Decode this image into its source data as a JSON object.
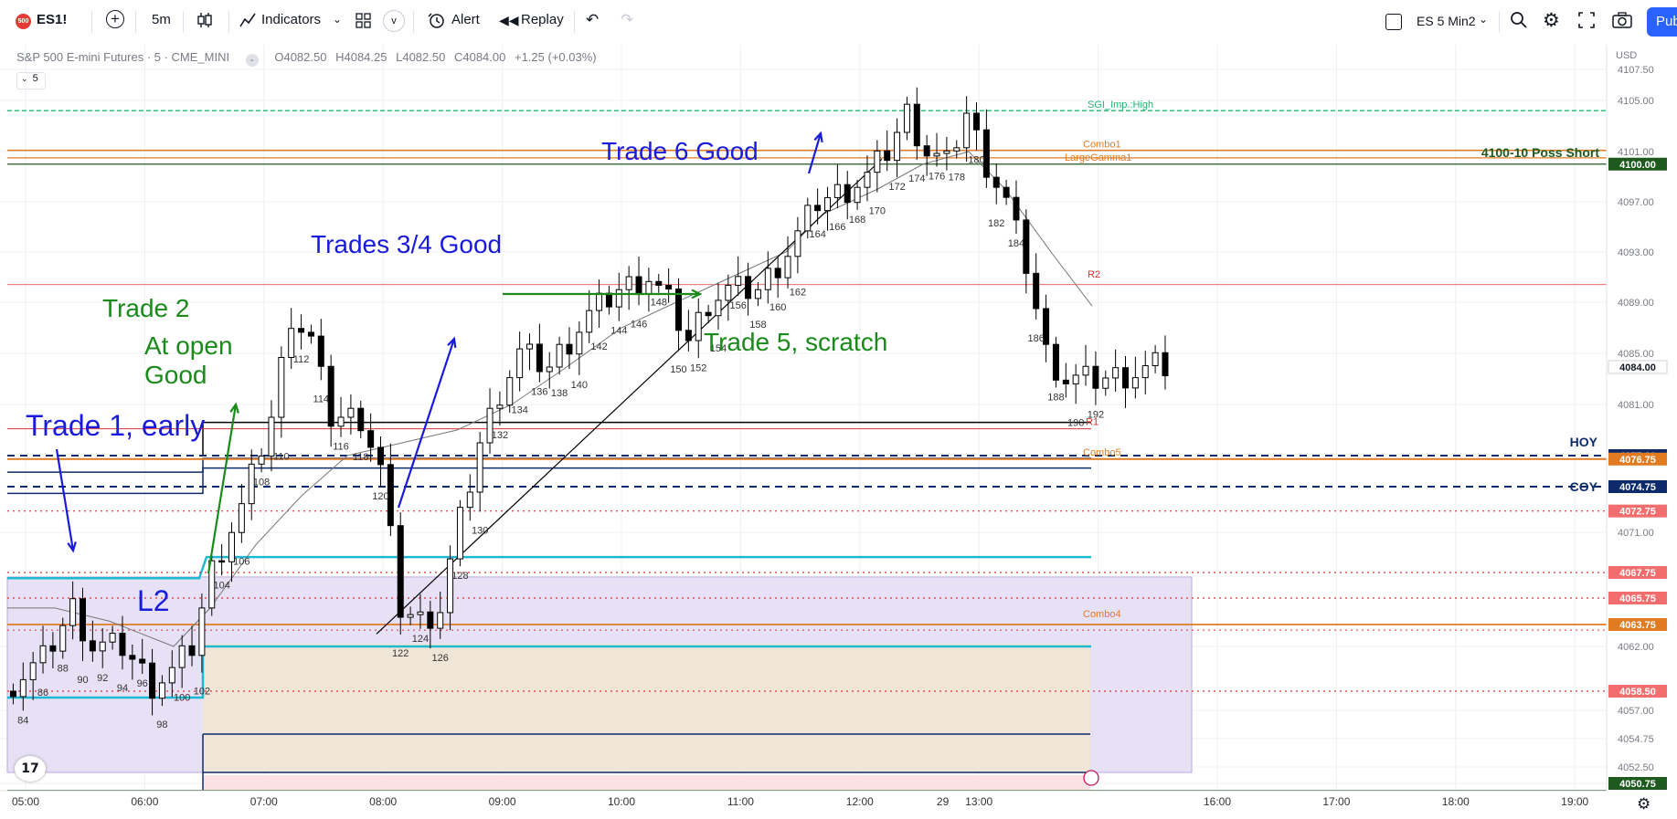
{
  "toolbar": {
    "symbol_badge": "500",
    "symbol": "ES1!",
    "interval": "5m",
    "indicators": "Indicators",
    "alert": "Alert",
    "replay": "Replay",
    "layout_name": "ES 5 Min2",
    "publish": "Pub"
  },
  "legend": {
    "title": "S&P 500 E-mini Futures · 5 · CME_MINI",
    "open": "O4082.50",
    "high": "H4084.25",
    "low": "L4082.50",
    "close": "C4084.00",
    "change": "+1.25 (+0.03%)",
    "study_count": "5"
  },
  "chart_data": {
    "type": "candlestick",
    "currency": "USD",
    "x_axis": {
      "ticks": [
        "05:00",
        "06:00",
        "07:00",
        "08:00",
        "09:00",
        "10:00",
        "11:00",
        "12:00",
        "13:00",
        "29",
        "16:00",
        "17:00",
        "18:00",
        "19:00"
      ]
    },
    "y_axis": {
      "ticks": [
        "4107.50",
        "4105.00",
        "4101.00",
        "4097.00",
        "4093.00",
        "4089.00",
        "4085.00",
        "4081.00",
        "4071.00",
        "4062.00",
        "4057.00",
        "4054.75",
        "4052.50",
        "4050.75"
      ]
    },
    "price_tags": [
      {
        "value": "4100.00",
        "bg": "#1e5a1e",
        "fg": "#ffffff"
      },
      {
        "value": "4084.00",
        "bg": "#ffffff",
        "fg": "#131722"
      },
      {
        "value": "4077.00",
        "bg": "#0d2b6b",
        "fg": "#ffffff"
      },
      {
        "value": "4076.75",
        "bg": "#e07b22",
        "fg": "#ffffff"
      },
      {
        "value": "4074.75",
        "bg": "#0d2b6b",
        "fg": "#ffffff"
      },
      {
        "value": "4072.75",
        "bg": "#f26d6d",
        "fg": "#ffffff"
      },
      {
        "value": "4067.75",
        "bg": "#f26d6d",
        "fg": "#ffffff"
      },
      {
        "value": "4065.75",
        "bg": "#f26d6d",
        "fg": "#ffffff"
      },
      {
        "value": "4063.75",
        "bg": "#e07b22",
        "fg": "#ffffff"
      },
      {
        "value": "4058.50",
        "bg": "#f26d6d",
        "fg": "#ffffff"
      },
      {
        "value": "4050.75",
        "bg": "#1e5a1e",
        "fg": "#ffffff"
      }
    ],
    "level_labels": [
      {
        "text": "SGI_Imp.:High",
        "color": "#22b573"
      },
      {
        "text": "Combo1",
        "color": "#e07b22"
      },
      {
        "text": "LargeGamma1",
        "color": "#e07b22"
      },
      {
        "text": "4100-10 Poss Short",
        "color": "#1e5a1e"
      },
      {
        "text": "R2",
        "color": "#e03030"
      },
      {
        "text": "R1",
        "color": "#e03030"
      },
      {
        "text": "HOY",
        "color": "#0d2b6b"
      },
      {
        "text": "COY",
        "color": "#0d2b6b"
      },
      {
        "text": "Combo5",
        "color": "#e07b22"
      },
      {
        "text": "Combo4",
        "color": "#e07b22"
      }
    ],
    "bar_numbers": [
      "84",
      "86",
      "88",
      "90",
      "92",
      "94",
      "96",
      "98",
      "100",
      "102",
      "104",
      "106",
      "108",
      "110",
      "112",
      "114",
      "116",
      "118",
      "120",
      "122",
      "124",
      "126",
      "128",
      "130",
      "132",
      "134",
      "136",
      "138",
      "140",
      "142",
      "144",
      "146",
      "148",
      "150",
      "152",
      "154",
      "156",
      "158",
      "160",
      "162",
      "164",
      "166",
      "168",
      "170",
      "172",
      "174",
      "176",
      "178",
      "180",
      "182",
      "184",
      "186",
      "188",
      "190",
      "192"
    ],
    "annotations": [
      {
        "text": "Trade 1, early",
        "color": "#1a1adb"
      },
      {
        "text": "L2",
        "color": "#1a1adb"
      },
      {
        "text": "Trade 2",
        "color": "#1a8a1a"
      },
      {
        "text": "At open",
        "color": "#1a8a1a"
      },
      {
        "text": "Good",
        "color": "#1a8a1a"
      },
      {
        "text": "Trades 3/4 Good",
        "color": "#1a1adb"
      },
      {
        "text": "Trade 5, scratch",
        "color": "#1a8a1a"
      },
      {
        "text": "Trade 6 Good",
        "color": "#1a1adb"
      }
    ]
  }
}
